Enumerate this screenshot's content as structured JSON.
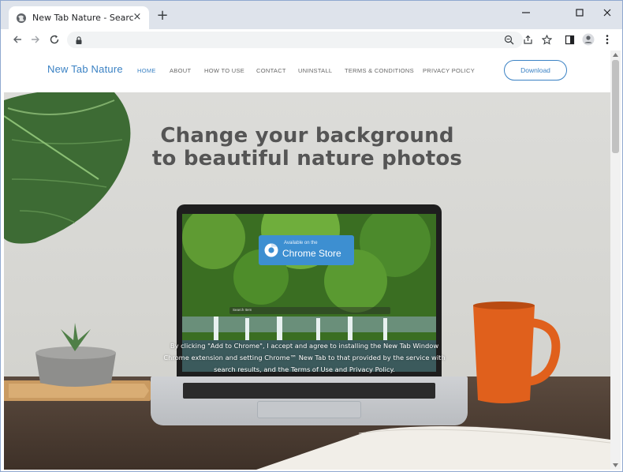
{
  "browser": {
    "tab_title": "New Tab Nature - Search the web",
    "new_tab_label": "+",
    "tab_close_label": "×",
    "tab_favicon": "globe-icon",
    "window_controls": [
      "minimize-icon",
      "maximize-icon",
      "close-icon"
    ],
    "nav_buttons": [
      "back-icon",
      "forward-icon",
      "reload-icon"
    ],
    "omnibox_icons": [
      "lock-icon",
      "zoom-icon",
      "share-icon",
      "star-icon"
    ],
    "toolbar_icons": [
      "sidebar-icon",
      "profile-icon",
      "menu-icon"
    ]
  },
  "site": {
    "logo": "New Tab Nature",
    "nav": [
      {
        "label": "HOME"
      },
      {
        "label": "ABOUT"
      },
      {
        "label": "HOW TO USE"
      },
      {
        "label": "CONTACT"
      },
      {
        "label": "UNINSTALL"
      },
      {
        "label": "TERMS & CONDITIONS"
      },
      {
        "label": "PRIVACY POLICY"
      }
    ],
    "download_label": "Download",
    "headline_line1": "Change your background",
    "headline_line2": "to beautiful nature photos",
    "badge_small": "Available on the",
    "badge_big": "Chrome Store",
    "screen_search_placeholder": "Search Item",
    "disclaimer": "By clicking \"Add to Chrome\", I accept and agree to installing the New Tab Window Chrome extension and setting Chrome™ New Tab to that provided by the service with search results, and the Terms of Use and Privacy Policy."
  },
  "colors": {
    "accent": "#3b82c4",
    "tabstrip": "#dee3eb",
    "badge": "#3d8fd1"
  }
}
